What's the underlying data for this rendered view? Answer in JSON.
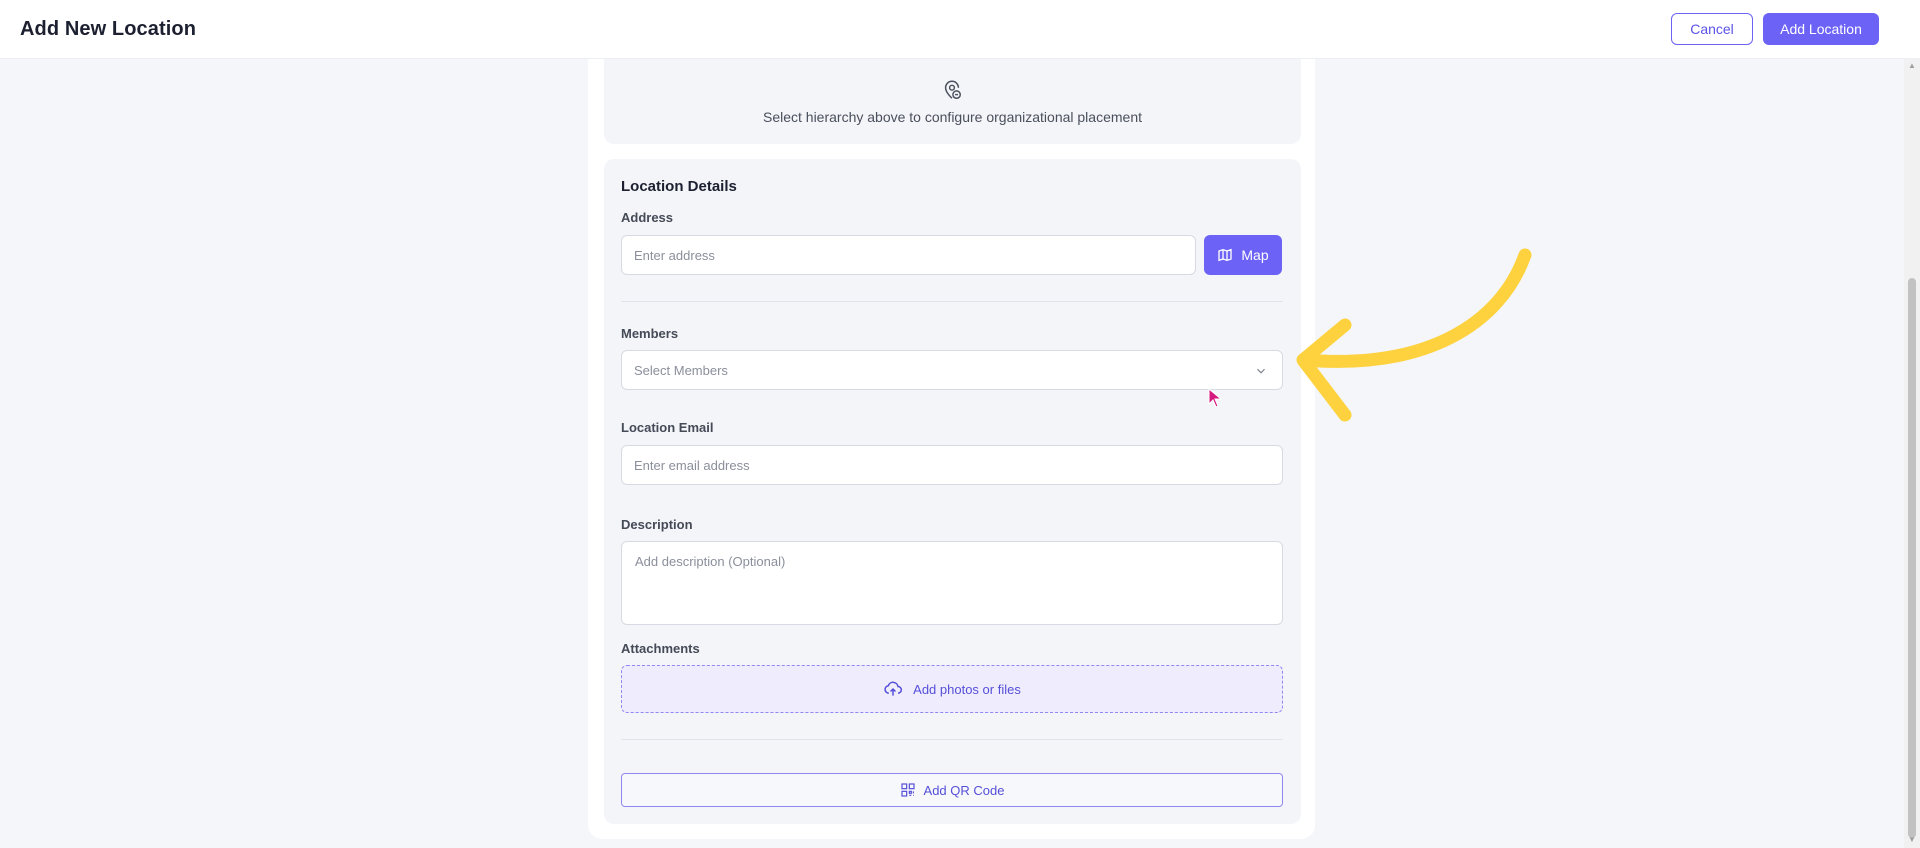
{
  "header": {
    "title": "Add New Location",
    "cancel_label": "Cancel",
    "add_label": "Add Location"
  },
  "hierarchy": {
    "icon": "location-hierarchy-icon",
    "text": "Select hierarchy above to configure organizational placement"
  },
  "details": {
    "title": "Location Details",
    "address": {
      "label": "Address",
      "placeholder": "Enter address"
    },
    "map_button": {
      "label": "Map",
      "icon": "map-icon"
    },
    "members": {
      "label": "Members",
      "placeholder": "Select Members"
    },
    "email": {
      "label": "Location Email",
      "placeholder": "Enter email address"
    },
    "description": {
      "label": "Description",
      "placeholder": "Add description (Optional)"
    },
    "attachments": {
      "label": "Attachments",
      "dropzone_text": "Add photos or files",
      "icon": "cloud-upload-icon"
    },
    "qr": {
      "label": "Add QR Code",
      "icon": "qr-code-icon"
    }
  },
  "colors": {
    "accent": "#6c63f6",
    "annotation": "#fdd23e",
    "cursor": "#d6197f"
  }
}
